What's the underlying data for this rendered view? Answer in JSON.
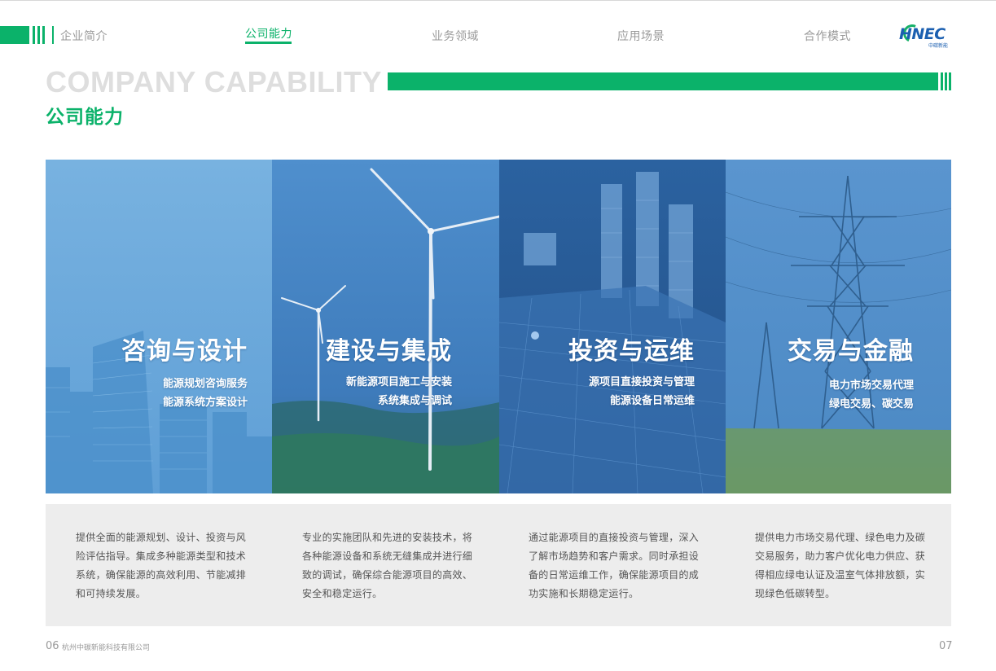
{
  "nav": {
    "items": [
      {
        "label": "企业简介",
        "active": false
      },
      {
        "label": "公司能力",
        "active": true
      },
      {
        "label": "业务领域",
        "active": false
      },
      {
        "label": "应用场景",
        "active": false
      },
      {
        "label": "合作模式",
        "active": false
      }
    ],
    "accent_color": "#0bb26a"
  },
  "logo": {
    "text": "HNEC",
    "subtitle": "中碳新能",
    "icon": "hnec-logo"
  },
  "heading": {
    "en": "COMPANY CAPABILITY",
    "cn": "公司能力"
  },
  "panels": [
    {
      "title": "咨询与设计",
      "lines": [
        "能源规划咨询服务",
        "能源系统方案设计"
      ],
      "image": "city-buildings-image",
      "description": "提供全面的能源规划、设计、投资与风险评估指导。集成多种能源类型和技术系统，确保能源的高效利用、节能减排和可持续发展。"
    },
    {
      "title": "建设与集成",
      "lines": [
        "新能源项目施工与安装",
        "系统集成与调试"
      ],
      "image": "wind-turbine-image",
      "description": "专业的实施团队和先进的安装技术，将各种能源设备和系统无缝集成并进行细致的调试，确保综合能源项目的高效、安全和稳定运行。"
    },
    {
      "title": "投资与运维",
      "lines": [
        "源项目直接投资与管理",
        "能源设备日常运维"
      ],
      "image": "solar-city-image",
      "description": "通过能源项目的直接投资与管理，深入了解市场趋势和客户需求。同时承担设备的日常运维工作，确保能源项目的成功实施和长期稳定运行。"
    },
    {
      "title": "交易与金融",
      "lines": [
        "电力市场交易代理",
        "绿电交易、碳交易"
      ],
      "image": "power-tower-image",
      "description": "提供电力市场交易代理、绿色电力及碳交易服务，助力客户优化电力供应、获得相应绿电认证及温室气体排放额，实现绿色低碳转型。"
    }
  ],
  "footer": {
    "left_page": "06",
    "company": "杭州中碳新能科技有限公司",
    "right_page": "07"
  }
}
